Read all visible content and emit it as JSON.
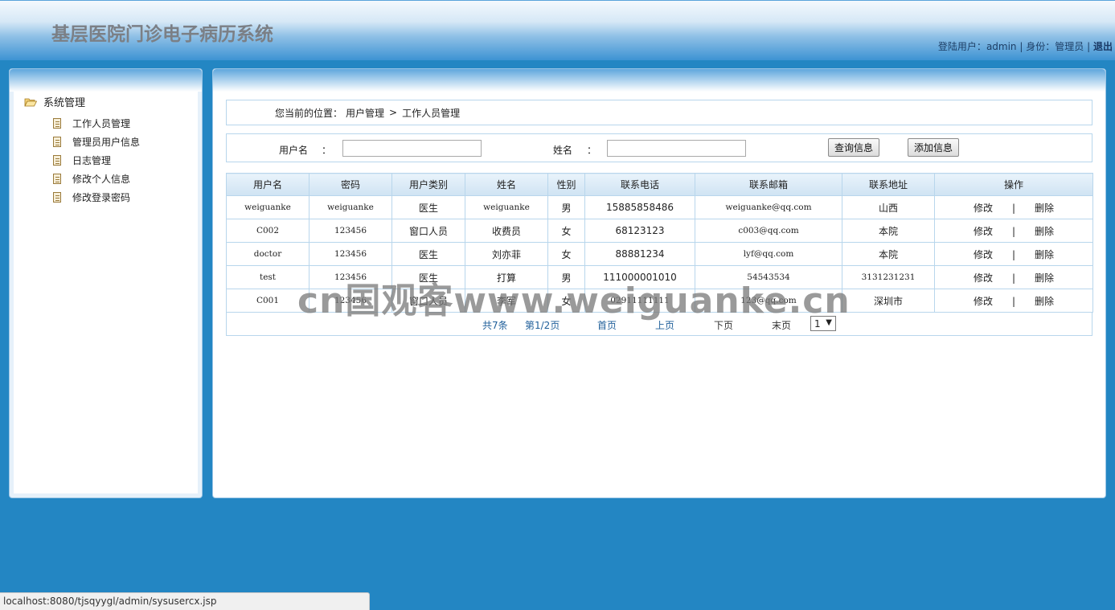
{
  "header": {
    "title": "基层医院门诊电子病历系统",
    "login_label": "登陆用户：",
    "username": "admin",
    "divider": "|",
    "role_label": "身份：",
    "role": "管理员",
    "logout": "退出"
  },
  "sidebar": {
    "root": "系统管理",
    "items": [
      {
        "label": "工作人员管理"
      },
      {
        "label": "管理员用户信息"
      },
      {
        "label": "日志管理"
      },
      {
        "label": "修改个人信息"
      },
      {
        "label": "修改登录密码"
      }
    ]
  },
  "breadcrumb": {
    "prefix": "您当前的位置：",
    "level1": "用户管理",
    "separator": ">",
    "level2": "工作人员管理"
  },
  "search": {
    "username_label": "用户名",
    "colon": "：",
    "name_label": "姓名",
    "username_value": "",
    "name_value": "",
    "query_button": "查询信息",
    "add_button": "添加信息"
  },
  "table": {
    "columns": [
      "用户名",
      "密码",
      "用户类别",
      "姓名",
      "性别",
      "联系电话",
      "联系邮箱",
      "联系地址",
      "操作"
    ],
    "rows": [
      [
        "weiguanke",
        "weiguanke",
        "医生",
        "weiguanke",
        "男",
        "15885858486",
        "weiguanke@qq.com",
        "山西"
      ],
      [
        "C002",
        "123456",
        "窗口人员",
        "收费员",
        "女",
        "68123123",
        "c003@qq.com",
        "本院"
      ],
      [
        "doctor",
        "123456",
        "医生",
        "刘亦菲",
        "女",
        "88881234",
        "lyf@qq.com",
        "本院"
      ],
      [
        "test",
        "123456",
        "医生",
        "打算",
        "男",
        "111000001010",
        "54543534",
        "3131231231"
      ],
      [
        "C001",
        "123456",
        "窗口人员",
        "李军",
        "女",
        "02911111111",
        "123@qq.com",
        "深圳市"
      ]
    ],
    "edit_label": "修改",
    "action_divider": "|",
    "delete_label": "删除"
  },
  "pager": {
    "total": "共7条",
    "page": "第1/2页",
    "first": "首页",
    "prev": "上页",
    "next": "下页",
    "last": "末页",
    "select_value": "1"
  },
  "watermark": "cn国观客www.weiguanke.cn",
  "statusbar": "localhost:8080/tjsqyygl/admin/sysusercx.jsp"
}
